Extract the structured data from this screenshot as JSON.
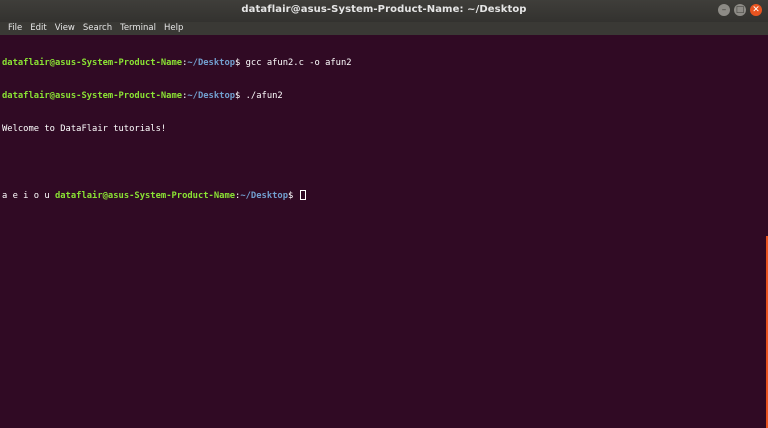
{
  "window": {
    "title": "dataflair@asus-System-Product-Name: ~/Desktop",
    "controls": {
      "minimize": "–",
      "maximize": "□",
      "close": "✕"
    }
  },
  "menu": [
    "File",
    "Edit",
    "View",
    "Search",
    "Terminal",
    "Help"
  ],
  "terminal": {
    "prompt_user": "dataflair@asus-System-Product-Name",
    "prompt_sep": ":",
    "prompt_path": "~/Desktop",
    "prompt_end": "$ ",
    "cmd1": "gcc afun2.c -o afun2",
    "cmd2": "./afun2",
    "out1": "Welcome to DataFlair tutorials!",
    "out2_prefix": "a e i o u "
  },
  "colors": {
    "bg": "#300a24",
    "user": "#8ae234",
    "path": "#729fcf",
    "accent": "#e95420"
  }
}
